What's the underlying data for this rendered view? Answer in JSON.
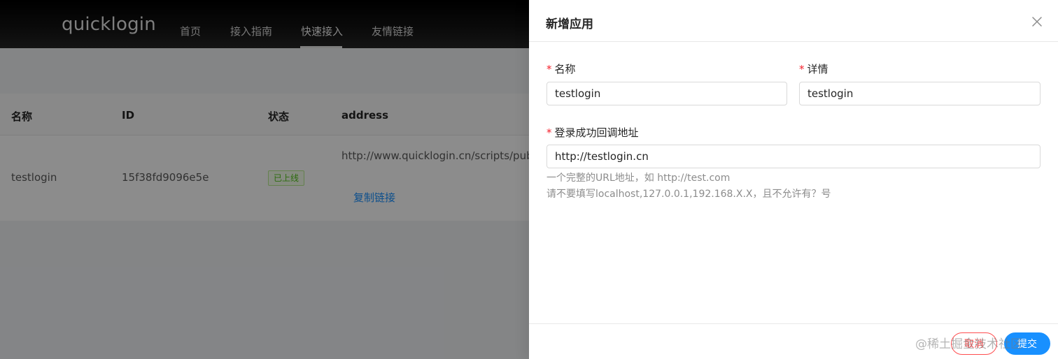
{
  "app": {
    "logo": "quicklogin",
    "nav": [
      "首页",
      "接入指南",
      "快速接入",
      "友情链接"
    ],
    "active_nav": "快速接入"
  },
  "table": {
    "columns": [
      "名称",
      "ID",
      "状态",
      "address"
    ],
    "row": {
      "name": "testlogin",
      "id": "15f38fd9096e5e",
      "status": "已上线",
      "address": "http://www.quicklogin.cn/scripts/public/",
      "action": "复制链接"
    }
  },
  "drawer": {
    "title": "新增应用",
    "fields": {
      "name": {
        "label": "名称",
        "value": "testlogin"
      },
      "detail": {
        "label": "详情",
        "value": "testlogin"
      },
      "callback": {
        "label": "登录成功回调地址",
        "value": "http://testlogin.cn"
      }
    },
    "help_lines": [
      "一个完整的URL地址，如 http://test.com",
      "请不要填写localhost,127.0.0.1,192.168.X.X，且不允许有？号"
    ],
    "buttons": {
      "cancel": "取消",
      "submit": "提交"
    },
    "required_mark": "*"
  },
  "watermark": "@稀土掘金技术社区",
  "colors": {
    "primary": "#1890ff",
    "danger": "#ff4d4f",
    "success": "#52c41a",
    "header_bg": "#000000"
  },
  "icons": {
    "close": "close-icon"
  }
}
